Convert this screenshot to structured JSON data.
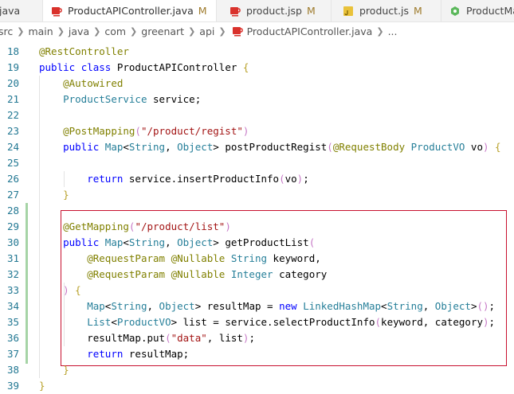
{
  "tabs": [
    {
      "label": "java",
      "active": false
    },
    {
      "label": "ProductAPIController.java",
      "modified": "M",
      "active": true
    },
    {
      "label": "product.jsp",
      "modified": "M",
      "active": false
    },
    {
      "label": "product.js",
      "modified": "M",
      "active": false
    },
    {
      "label": "ProductMa",
      "active": false
    }
  ],
  "close_glyph": "×",
  "breadcrumb": [
    "src",
    "main",
    "java",
    "com",
    "greenart",
    "api",
    "ProductAPIController.java",
    "..."
  ],
  "code_lines": [
    {
      "n": "18",
      "text": "@RestController"
    },
    {
      "n": "19",
      "text": "public class ProductAPIController {"
    },
    {
      "n": "20",
      "text": "    @Autowired"
    },
    {
      "n": "21",
      "text": "    ProductService service;"
    },
    {
      "n": "22",
      "text": ""
    },
    {
      "n": "23",
      "text": "    @PostMapping(\"/product/regist\")"
    },
    {
      "n": "24",
      "text": "    public Map<String, Object> postProductRegist(@RequestBody ProductVO vo) {"
    },
    {
      "n": "25",
      "text": ""
    },
    {
      "n": "26",
      "text": "        return service.insertProductInfo(vo);"
    },
    {
      "n": "27",
      "text": "    }"
    },
    {
      "n": "28",
      "text": ""
    },
    {
      "n": "29",
      "text": "    @GetMapping(\"/product/list\")"
    },
    {
      "n": "30",
      "text": "    public Map<String, Object> getProductList("
    },
    {
      "n": "31",
      "text": "        @RequestParam @Nullable String keyword,"
    },
    {
      "n": "32",
      "text": "        @RequestParam @Nullable Integer category"
    },
    {
      "n": "33",
      "text": "    ) {"
    },
    {
      "n": "34",
      "text": "        Map<String, Object> resultMap = new LinkedHashMap<String, Object>();"
    },
    {
      "n": "35",
      "text": "        List<ProductVO> list = service.selectProductInfo(keyword, category);"
    },
    {
      "n": "36",
      "text": "        resultMap.put(\"data\", list);"
    },
    {
      "n": "37",
      "text": "        return resultMap;"
    },
    {
      "n": "38",
      "text": "    }"
    },
    {
      "n": "39",
      "text": "}"
    }
  ],
  "colors": {
    "annotation": "#808000",
    "keyword": "#0000ff",
    "type": "#267f99",
    "string": "#a31515",
    "line_number": "#237893",
    "highlight_box": "#c8102e",
    "modified_marker": "#9e7a2b"
  },
  "icons": {
    "java_tab": "java-file-icon",
    "jsp_tab": "jsp-file-icon",
    "js_tab": "js-file-icon",
    "other_tab": "java-class-icon"
  }
}
